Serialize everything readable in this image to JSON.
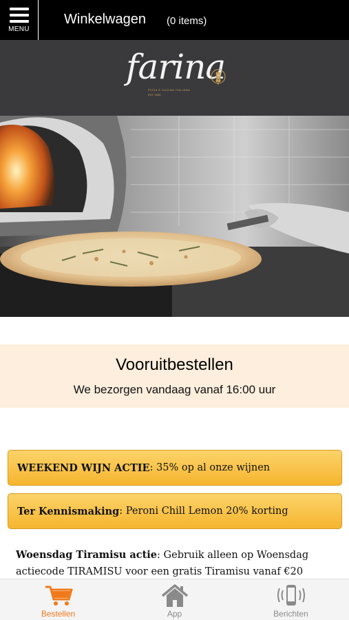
{
  "header": {
    "menu_label": "MENU",
    "title": "Winkelwagen",
    "item_count": "(0 items)"
  },
  "logo": {
    "name": "farina",
    "tagline": "PIZZA E CUCINA ITALIANA",
    "established": "EST. 2006"
  },
  "promo": {
    "title": "Vooruitbestellen",
    "subtitle": "We bezorgen vandaag vanaf 16:00 uur"
  },
  "deals": [
    {
      "label": "WEEKEND WIJN ACTIE",
      "text": ": 35% op al onze wijnen"
    },
    {
      "label": "Ter Kennismaking",
      "text": ": Peroni Chill Lemon 20% korting"
    }
  ],
  "info": {
    "label": "Woensdag Tiramisu actie",
    "text": ": Gebruik alleen op Woensdag actiecode TIRAMISU voor een gratis Tiramisu vanaf €20"
  },
  "tabs": [
    {
      "label": "Bestellen",
      "icon": "cart-icon",
      "active": true
    },
    {
      "label": "App",
      "icon": "home-icon",
      "active": false
    },
    {
      "label": "Berichten",
      "icon": "phone-vibrate-icon",
      "active": false
    }
  ],
  "colors": {
    "accent": "#f07a1b",
    "deal_bg": "#f9c446",
    "promo_bg": "#fdeedd",
    "logo_band": "#3a3a3c"
  }
}
